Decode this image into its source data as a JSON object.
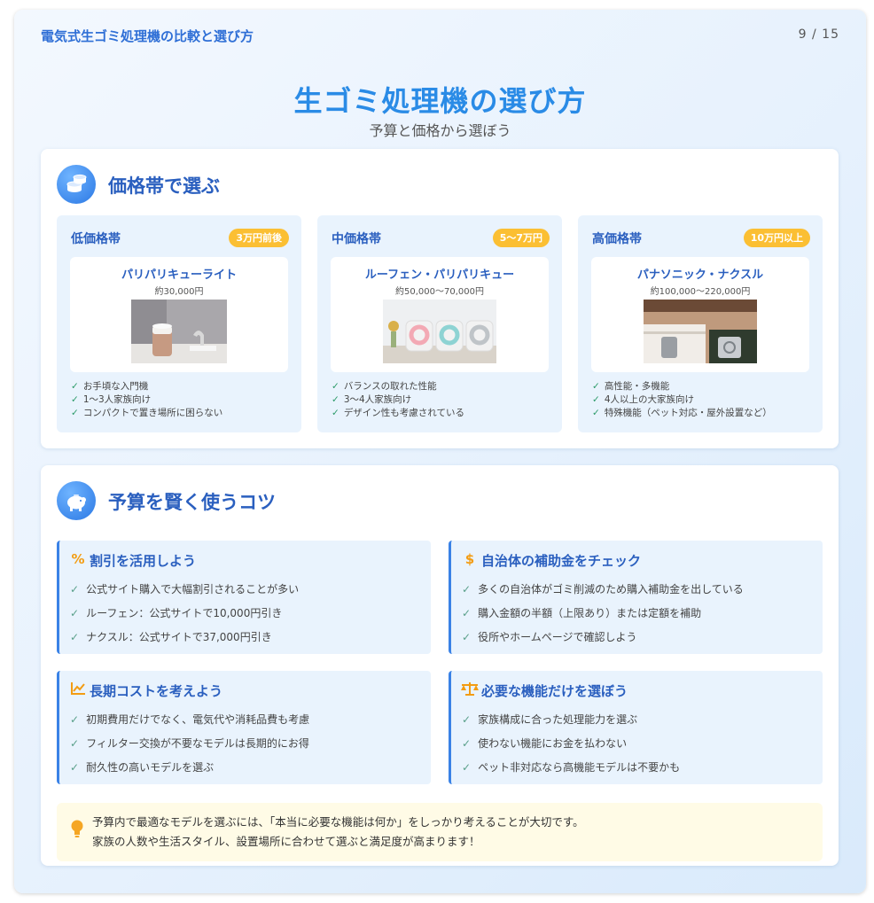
{
  "header": {
    "deck_title": "電気式生ゴミ処理機の比較と選び方",
    "page_indicator": "9 / 15"
  },
  "slide": {
    "title": "生ゴミ処理機の選び方",
    "subtitle": "予算と価格から選ぼう"
  },
  "price_section": {
    "title": "価格帯で選ぶ",
    "icon": "coins-icon",
    "tiers": [
      {
        "name": "低価格帯",
        "badge": "3万円前後",
        "product": "パリパリキューライト",
        "price": "約30,000円",
        "features": [
          "お手頃な入門機",
          "1～3人家族向け",
          "コンパクトで置き場所に困らない"
        ]
      },
      {
        "name": "中価格帯",
        "badge": "5～7万円",
        "product": "ルーフェン・パリパリキュー",
        "price": "約50,000～70,000円",
        "features": [
          "バランスの取れた性能",
          "3～4人家族向け",
          "デザイン性も考慮されている"
        ]
      },
      {
        "name": "高価格帯",
        "badge": "10万円以上",
        "product": "パナソニック・ナクスル",
        "price": "約100,000～220,000円",
        "features": [
          "高性能・多機能",
          "4人以上の大家族向け",
          "特殊機能（ペット対応・屋外設置など）"
        ]
      }
    ]
  },
  "budget_section": {
    "title": "予算を賢く使うコツ",
    "icon": "piggy-bank-icon",
    "tips": [
      {
        "icon": "percent-icon",
        "icon_glyph": "%",
        "title": "割引を活用しよう",
        "items": [
          "公式サイト購入で大幅割引されることが多い",
          "ルーフェン：公式サイトで10,000円引き",
          "ナクスル：公式サイトで37,000円引き"
        ]
      },
      {
        "icon": "hand-coin-icon",
        "icon_glyph": "$",
        "title": "自治体の補助金をチェック",
        "items": [
          "多くの自治体がゴミ削減のため購入補助金を出している",
          "購入金額の半額（上限あり）または定額を補助",
          "役所やホームページで確認しよう"
        ]
      },
      {
        "icon": "chart-line-icon",
        "icon_glyph": "📈",
        "title": "長期コストを考えよう",
        "items": [
          "初期費用だけでなく、電気代や消耗品費も考慮",
          "フィルター交換が不要なモデルは長期的にお得",
          "耐久性の高いモデルを選ぶ"
        ]
      },
      {
        "icon": "scale-icon",
        "icon_glyph": "⚖",
        "title": "必要な機能だけを選ぼう",
        "items": [
          "家族構成に合った処理能力を選ぶ",
          "使わない機能にお金を払わない",
          "ペット非対応なら高機能モデルは不要かも"
        ]
      }
    ]
  },
  "note": {
    "icon": "lightbulb-icon",
    "line1": "予算内で最適なモデルを選ぶには、「本当に必要な機能は何か」をしっかり考えることが大切です。",
    "line2": "家族の人数や生活スタイル、設置場所に合わせて選ぶと満足度が高まります！"
  },
  "colors": {
    "accent": "#2a8be6",
    "heading": "#2a5fbf",
    "badge": "#fbbf33",
    "tip_border": "#3a82e6",
    "note_bg": "#fffbe6"
  }
}
